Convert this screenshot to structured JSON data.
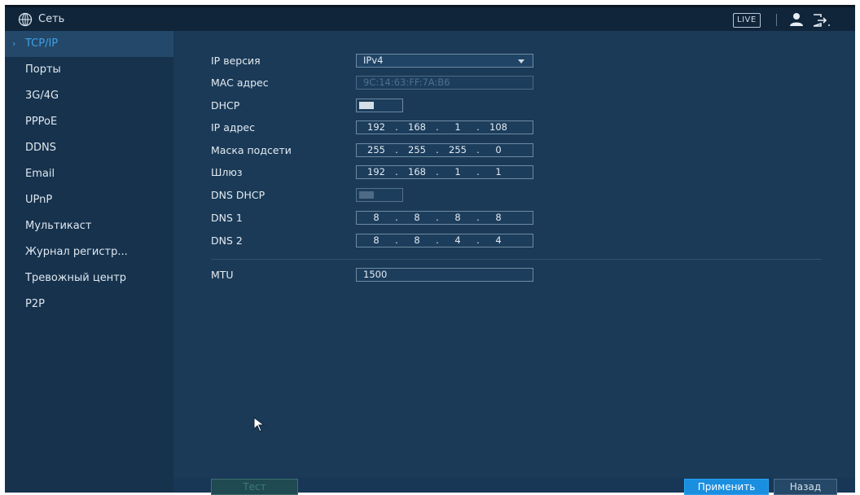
{
  "header": {
    "title": "Сеть",
    "live_label": "LIVE",
    "icons": [
      "globe-icon",
      "user-icon",
      "logout-icon"
    ]
  },
  "sidebar": {
    "items": [
      {
        "label": "TCP/IP",
        "active": true
      },
      {
        "label": "Порты"
      },
      {
        "label": "3G/4G"
      },
      {
        "label": "PPPoE"
      },
      {
        "label": "DDNS"
      },
      {
        "label": "Email"
      },
      {
        "label": "UPnP"
      },
      {
        "label": "Мультикаст"
      },
      {
        "label": "Журнал регистр..."
      },
      {
        "label": "Тревожный центр"
      },
      {
        "label": "P2P"
      }
    ]
  },
  "form": {
    "ip_version": {
      "label": "IP версия",
      "value": "IPv4"
    },
    "mac": {
      "label": "MAC адрес",
      "value": "9C:14:63:FF:7A:B6"
    },
    "dhcp": {
      "label": "DHCP",
      "enabled": true
    },
    "ip": {
      "label": "IP адрес",
      "octets": [
        "192",
        "168",
        "1",
        "108"
      ]
    },
    "mask": {
      "label": "Маска подсети",
      "octets": [
        "255",
        "255",
        "255",
        "0"
      ]
    },
    "gateway": {
      "label": "Шлюз",
      "octets": [
        "192",
        "168",
        "1",
        "1"
      ]
    },
    "dns_dhcp": {
      "label": "DNS DHCP",
      "enabled": false
    },
    "dns1": {
      "label": "DNS 1",
      "octets": [
        "8",
        "8",
        "8",
        "8"
      ]
    },
    "dns2": {
      "label": "DNS 2",
      "octets": [
        "8",
        "8",
        "4",
        "4"
      ]
    },
    "mtu": {
      "label": "MTU",
      "value": "1500"
    }
  },
  "buttons": {
    "test": "Тест",
    "apply": "Применить",
    "back": "Назад"
  },
  "colors": {
    "background": "#1a3a57",
    "sidebar": "#16324d",
    "accent": "#1a8fe0",
    "active_text": "#3ea0e6"
  }
}
